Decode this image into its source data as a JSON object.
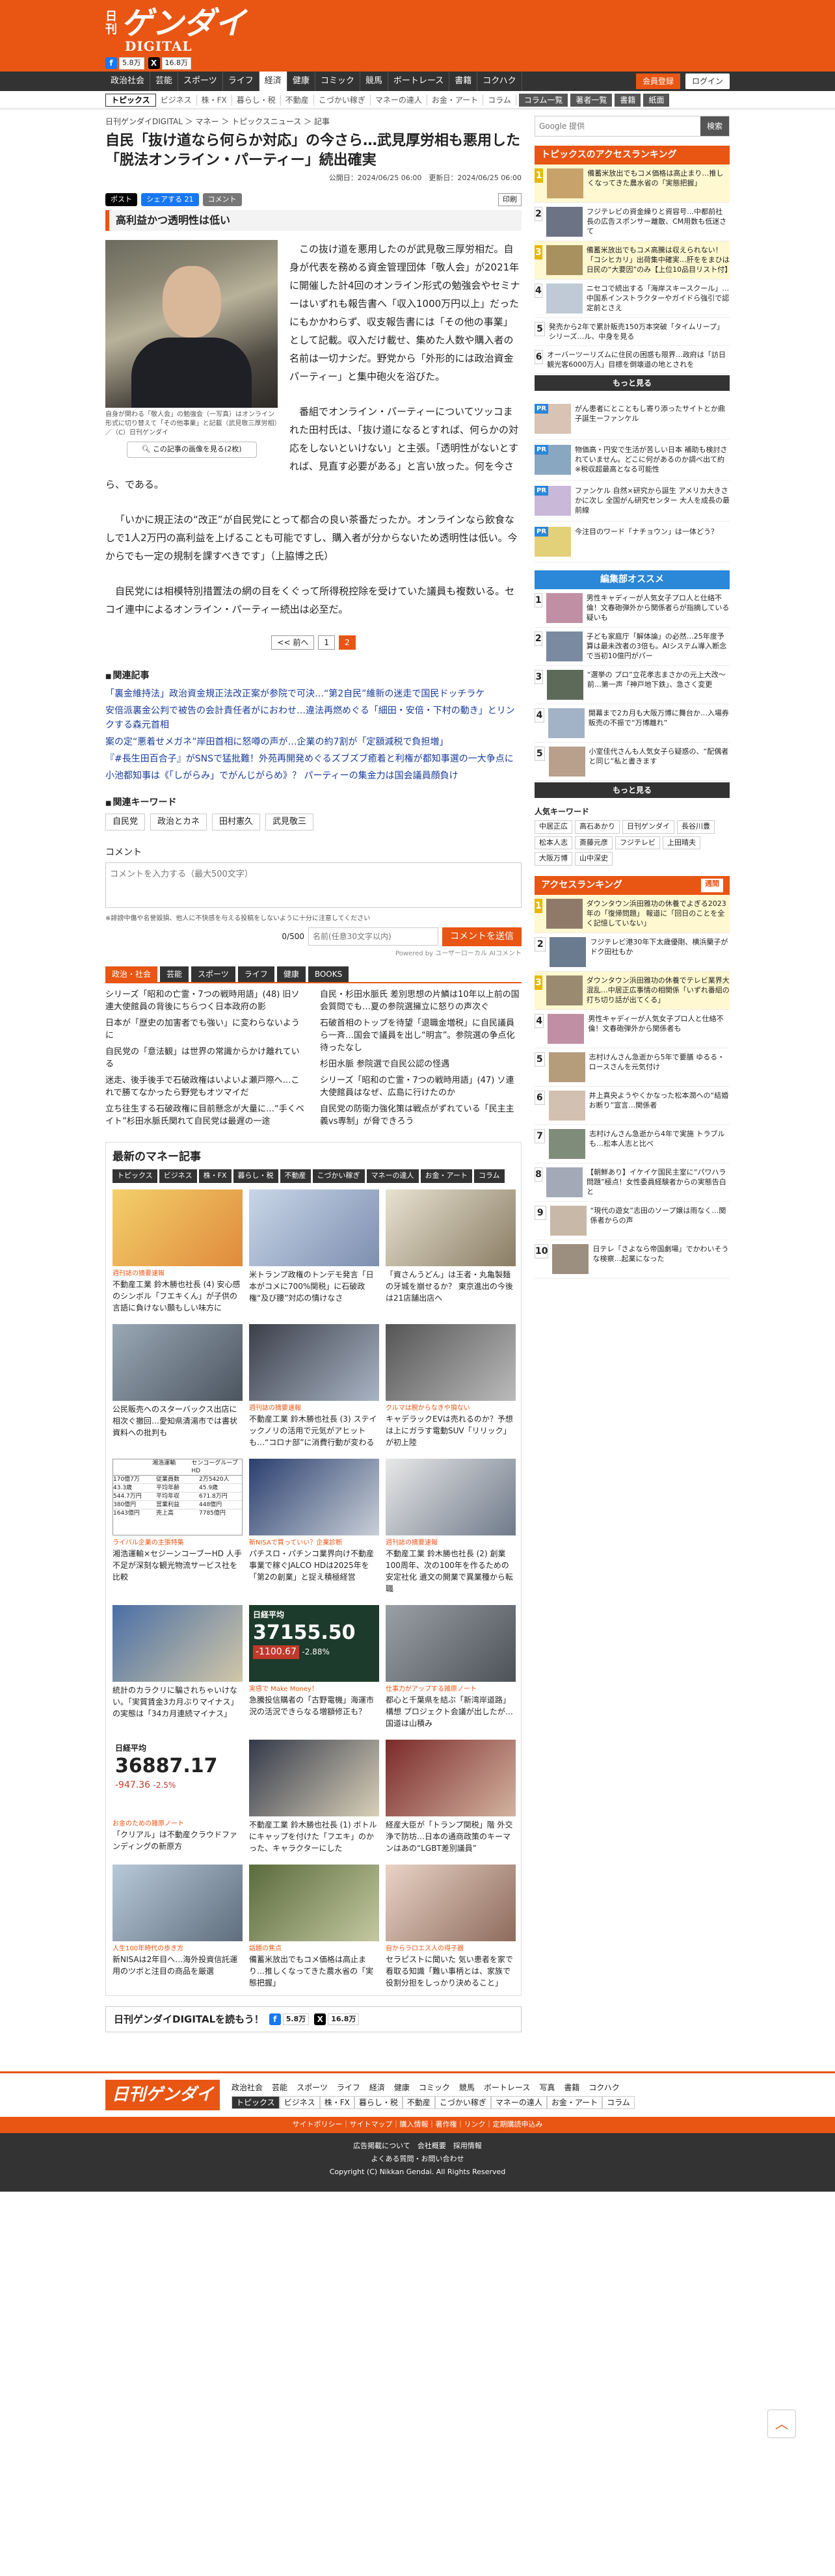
{
  "brand": {
    "nikkan": "日刊",
    "logo": "ゲンダイ",
    "digital": "DIGITAL"
  },
  "social": {
    "fb_count": "5.8万",
    "x_count": "16.8万"
  },
  "gnav": [
    "政治社会",
    "芸能",
    "スポーツ",
    "ライフ",
    "経済",
    "健康",
    "コミック",
    "競馬",
    "ボートレース",
    "書籍",
    "コクハク"
  ],
  "gnav_active": "経済",
  "member_btn": "会員登録",
  "login_btn": "ログイン",
  "subnav": [
    "トピックス",
    "ビジネス",
    "株・FX",
    "暮らし・税",
    "不動産",
    "こづかい稼ぎ",
    "マネーの達人",
    "お金・アート",
    "コラム"
  ],
  "subnav_tags": [
    "コラム一覧",
    "著者一覧",
    "書籍",
    "紙面"
  ],
  "breadcrumb": "日刊ゲンダイDIGITAL ＞ マネー ＞ トピックスニュース ＞ 記事",
  "title": "自民「抜け道なら何らか対応」の今さら…武見厚労相も悪用した「脱法オンライン・パーティー」続出確実",
  "dates": "公開日：2024/06/25 06:00　更新日：2024/06/25 06:00",
  "share": {
    "post": "ポスト",
    "fb": "シェアする 21",
    "comment": "コメント",
    "print": "印刷"
  },
  "subheading": "高利益かつ透明性は低い",
  "photo": {
    "caption": "自身が関わる「敬人会」の勉強会（一写真）はオンライン形式に切り替えて「その他事業」と記載（武見敬三厚労相）／（C）日刊ゲンダイ",
    "zoom": "この記事の画像を見る(2枚)"
  },
  "paras": [
    "この抜け道を悪用したのが武見敬三厚労相だ。自身が代表を務める資金管理団体「敬人会」が2021年に開催した計4回のオンライン形式の勉強会やセミナーはいずれも報告書へ「収入1000万円以上」だったにもかかわらず、収支報告書には「その他の事業」として記載。収入だけ載せ、集めた人数や購入者の名前は一切ナシだ。野党から「外形的には政治資金パーティー」と集中砲火を浴びた。",
    "番組でオンライン・パーティーについてツッコまれた田村氏は、「抜け道になるとすれば、何らかの対応をしないといけない」と主張。「透明性がないとすれば、見直す必要がある」と言い放った。何を今さら、である。",
    "「いかに規正法の“改正”が自民党にとって都合の良い茶番だったか。オンラインなら飲食なしで1人2万円の高利益を上げることも可能ですし、購入者が分からないため透明性は低い。今からでも一定の規制を課すべきです」（上脇博之氏）",
    "自民党には相模特別措置法の網の目をくぐって所得税控除を受けていた議員も複数いる。セコイ連中によるオンライン・パーティー続出は必至だ。"
  ],
  "pager": {
    "prev": "<< 前へ",
    "p1": "1",
    "p2": "2"
  },
  "related_h": "関連記事",
  "related": [
    "「裏金維持法」政治資金規正法改正案が参院で可決…“第2自民”維新の迷走で国民ドッチラケ",
    "安倍派裏金公判で被告の会計責任者がにおわせ…違法再燃めぐる「細田・安倍・下村の動き」とリンクする森元首相",
    "案の定“悪着せメガネ”岸田首相に怒噂の声が…企業の約7割が「定額減税で負担増」",
    "『#長生田百合子』がSNSで猛批難！外苑再開発めぐるズブズブ癒着と利権が都知事選の一大争点に",
    "小池都知事は《「しがらみ」でがんじがらめ》？ パーティーの集金力は国会議員顔負け"
  ],
  "kw_h": "関連キーワード",
  "keywords": [
    "自民党",
    "政治とカネ",
    "田村憲久",
    "武見敬三"
  ],
  "comment": {
    "label": "コメント",
    "placeholder": "コメントを入力する（最大500文字）",
    "note": "※誹謗中傷や名誉毀損、他人に不快感を与える投稿をしないように十分に注意してください",
    "count": "0/500",
    "name_ph": "名前(任意30文字以内)",
    "send": "コメントを送信",
    "powered": "Powered by ユーザーローカル AIコメント"
  },
  "tabs": [
    "政治・社会",
    "芸能",
    "スポーツ",
    "ライフ",
    "健康",
    "BOOKS"
  ],
  "news_left": [
    "シリーズ「昭和の亡霊・7つの戦時用語」(48) 旧ソ連大使館員の背後にちらつく日本政府の影",
    "日本が「歴史の加害者でも強い」に変わらないように",
    "自民党の「意法観」は世界の常識からかけ離れている",
    "迷走、後手後手で石破政権はいよいよ瀬戸際へ…これで勝てなかったら野党もオツマイだ",
    "立ち往生する石破政権に目前懸念が大量に…“手くベイト”杉田水脈氏関れて自民党は最遅の一途"
  ],
  "news_right": [
    "自民・杉田水脈氏 差別思想の片鱗は10年以上前の国会質問でも…夏の参院選擁立に怒りの声次ぐ",
    "石破首相のトップを待望「退職金増税」に自民議員ら一斉…国会で議員を出し“明言”。参院選の争点化待ったなし",
    "杉田水脈 参院選で自民公認の怪遇",
    "シリーズ「昭和の亡霊・7つの戦時用語」(47) ソ連大使館員はなぜ、広島に行けたのか",
    "自民党の防衛力強化策は戦点がずれている「民主主義vs専制」が脅できろう"
  ],
  "money_h": "最新のマネー記事",
  "money_tabs": [
    "トピックス",
    "ビジネス",
    "株・FX",
    "暮らし・税",
    "不動産",
    "こづかい稼ぎ",
    "マネーの達人",
    "お金・アート",
    "コラム"
  ],
  "cards": [
    {
      "cat": "週刊誌の摘要速報",
      "t": "不動産工業 鈴木勝也社長 (4) 安心感のシンボル「フエキくん」が子供の言語に負けない願もしい味方に"
    },
    {
      "cat": "",
      "t": "米トランプ政権のトンデモ発言「日本がコメに700%関税」に石破政権“及び腰”対応の情けなさ"
    },
    {
      "cat": "",
      "t": "「資さんうどん」は王者・丸亀製麺の牙城を崩せるか？ 東京進出の今後は21店舗出店へ"
    },
    {
      "cat": "",
      "t": "公民販売へのスターバックス出店に相次ぐ撤回…愛知県清湯市では書状資料への批判も"
    },
    {
      "cat": "週刊誌の摘要速報",
      "t": "不動産工業 鈴木勝也社長 (3) ステイックノリの活用で元気がアヒットも…“コロナ部”に消費行動が変わる"
    },
    {
      "cat": "クルマは腕からなきや損ない",
      "t": "キャデラックEVは売れるのか？予想は上にガラす電動SUV「リリック」が初上陸"
    },
    {
      "cat": "ライバル企業の主張特集",
      "t": "湘浩運輸×セジーンコーブーHD 人手不足が深刻な観光物流サービス社を比較"
    },
    {
      "cat": "新NISAで買っていい？企業診断",
      "t": "パチスロ・パチンコ業界向け不動産事業で稼ぐJALCO HDは2025年を「第2の創業」と捉え積極経営"
    },
    {
      "cat": "週刊誌の摘要速報",
      "t": "不動産工業 鈴木勝也社長 (2) 創業100周年、次の100年を作るための安定社化 遺文の開業で異業種から転職"
    },
    {
      "cat": "",
      "t": "統計のカラクリに騙されちゃいけない。「実質賃金3カ月ぶりマイナス」の実態は「34カ月連続マイナス」"
    },
    {
      "cat": "実感で Make Money！",
      "t": "急騰投信購者の「古野電機」海運市況の活況できらなる増額修正も？"
    },
    {
      "cat": "仕事力がアップする雑原ノート",
      "t": "都心と千葉県を結ぶ「新湾岸道路」構想 プロジェクト会議が出したが…国道は山積み"
    },
    {
      "cat": "お金のための雑原ノート",
      "t": "「クリアル」は不動産クラウドファンディングの新原方"
    },
    {
      "cat": "",
      "t": "不動産工業 鈴木勝也社長 (1) ボトルにキャップを付けた「フエキ」のかった、キャラクターにした"
    },
    {
      "cat": "",
      "t": "経産大臣が「トランプ関税」階 外交浄で防坊…日本の通商政策のキーマンはあの“LGBT差別議員”"
    },
    {
      "cat": "人生100年時代の歩き方",
      "t": "新NISAは2年目へ…海外投資信託運用のツボと注目の商品を厳選"
    },
    {
      "cat": "話題の焦点",
      "t": "備蓄米放出でもコメ価格は高止まり…推しくなってきた農水省の「実態把握」"
    },
    {
      "cat": "自からラロエス人の得子器",
      "t": "セラピストに聞いた 気い患者を家で看取る知識「難い事柄とは、家族で役割分担をしっかり決めること」"
    }
  ],
  "nikkei1": {
    "label": "日経平均",
    "value": "37155.50",
    "change": "-1100.67",
    "pct": "-2.88%"
  },
  "nikkei2": {
    "label": "日経平均",
    "value": "36887.17",
    "change": "-947.36",
    "pct": "-2.5%"
  },
  "table_widget": {
    "hdr1": "湘浩運輸",
    "hdr2": "センコーグループHD",
    "rows": [
      [
        "170億7万",
        "従業員数",
        "2万5420人"
      ],
      [
        "43.3歳",
        "平均年齢",
        "45.9歳"
      ],
      [
        "544.7万円",
        "平均年収",
        "671.8万円"
      ],
      [
        "380億円",
        "営業利益",
        "448億円"
      ],
      [
        "1643億円",
        "売上高",
        "7785億円"
      ]
    ]
  },
  "follow": {
    "text": "日刊ゲンダイDIGITALを読もう！",
    "fb": "5.8万",
    "x": "16.8万"
  },
  "search": {
    "placeholder": "Google 提供",
    "btn": "検索"
  },
  "rank1_h": "トピックスのアクセスランキング",
  "rank1": [
    "備蓄米放出でもコメ価格は高止まり…推しくなってきた農水省の「実態把握」",
    "フジテレビの資金繰りと資容号…中都前社長の広告スポンサー離散、CM用数も低迷さて",
    "備蓄米放出でもコメ高騰は収えられない！「コシヒカリ」出荷集中確実…肝ををまひは日民の“大要因”のみ【上位10品目リスト付】",
    "ニセコで続出する「海岸スキースクール」…中国系インストラクターやガイドら強引で認定前とさえ"
  ],
  "rank1b": [
    "発売から2年で累計販売150万本突破「タイムリープ」シリーズ…ル、中身を見る",
    "オーバーツーリズムに住民の困惑も限界…政府は「訪日観光客6000万人」目標を倒壊道の地とされを"
  ],
  "more": "もっと見る",
  "pr_items": [
    "がん患者にとこともし寄り添ったサイトとか鼎子誕生ーファンケル",
    "物価高・円安で生活が苦しい日本 補助も検討されていません。どこに何があるのか調べ出て約 ※税収超最高となる可能性",
    "ファンケル 自然×研究から誕生 アメリカ大きさかに次し 全国がん研究センター 大人を成長の最前線",
    "今注目のワード「ナチョウン」は一体どう？"
  ],
  "pr_label": "PR",
  "rec_h": "編集部オススメ",
  "rec": [
    "男性キャディーが人気女子プロ人と仕絡不倫！文春砲弾外から関係者らが指摘している疑いも",
    "子ども家庭庁「解体論」の必然…25年度予算は最未改者の3倍も。AIシステム導入断念で当初10億円がパー",
    "“選挙の プロ”立花孝志まさかの元上大改～前…第一声「神戸地下鉄」、急さく変更",
    "開幕まで2カ月も大阪万博に舞台か…入場券販売の不振で“万博離れ”",
    "小室佳代さんも人気女子ら疑惑の、“配偶者と同じ”私と書きます"
  ],
  "pop_h": "人気キーワード",
  "pop_tags": [
    "中居正広",
    "高石あかり",
    "日刊ゲンダイ",
    "長谷川豊",
    "松本人志",
    "斎藤元彦",
    "フジテレビ",
    "上田晴夫",
    "大阪万博",
    "山中深史"
  ],
  "rank2_h": "アクセスランキング",
  "rank2_tag": "週間",
  "rank2": [
    "ダウンタウン浜田雅功の休養でよぎる2023年の「復帰問題」 報道に「回日のことを全く記憶していない」",
    "フジテレビ港30年下太歳優剛、横浜蘭子がドク田社もか",
    "ダウンタウン浜田雅功の休養でテレビ業界大混乱…中居正広事情の相関係「いずれ番組の打ち切り話が出てくる」",
    "男性キャディーが人気女子プロ人と仕絡不倫！文春砲弾外から関係者も",
    "志村けんさん急逝から5年で要膳 ゆるる・ロースさんを元気付け",
    "井上真央ようやくかなった松本潤への“結婚お断り”宣言…関係者",
    "志村けんさん急逝から4年で実施 トラブルも…松本人志と比べ",
    "【朝鮮あり】イケイケ国民主室に“パワハラ問題”極点！女性委員経験者からの実態告白と",
    "“現代の遊女”志田のソープ嬢は雨なく…関係者からの声",
    "日テレ「さよなら帝国劇場」でかわいそうな検察…起業になった"
  ],
  "footer_nav": [
    "政治社会",
    "芸能",
    "スポーツ",
    "ライフ",
    "経済",
    "健康",
    "コミック",
    "競馬",
    "ボートレース",
    "写真",
    "書籍",
    "コクハク"
  ],
  "footer_nav2": [
    "トピックス",
    "ビジネス",
    "株・FX",
    "暮らし・税",
    "不動産",
    "こづかい稼ぎ",
    "マネーの達人",
    "お金・アート",
    "コラム"
  ],
  "sitemap": "サイトポリシー｜サイトマップ｜購入情報｜著作権｜リンク｜定期購読申込み",
  "foot_links": "広告掲載について　会社概要　採用情報",
  "foot_links2": "よくある質問・お問い合わせ",
  "copyright": "Copyright (C) Nikkan Gendai. All Rights Reserved"
}
